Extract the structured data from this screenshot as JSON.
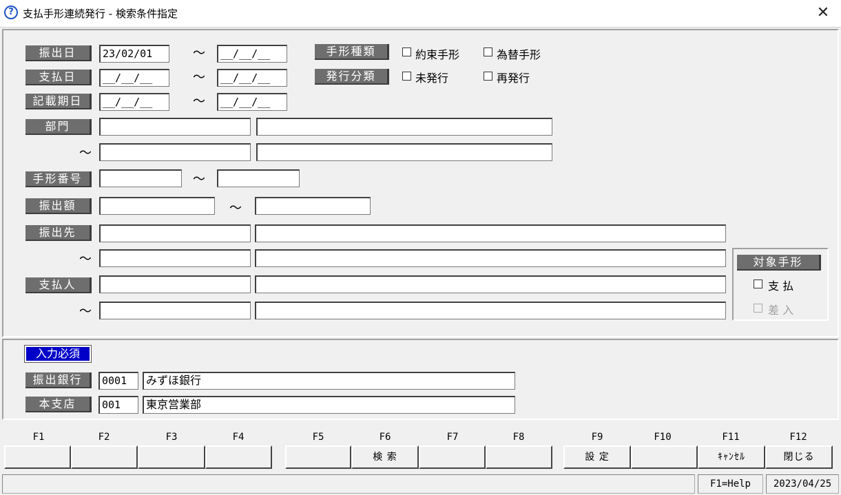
{
  "window": {
    "title": "支払手形連続発行 - 検索条件指定",
    "close": "✕"
  },
  "form": {
    "furidashi_date": {
      "label": "振出日",
      "from": "23/02/01",
      "to": "__/__/__"
    },
    "shiharai_date": {
      "label": "支払日",
      "from": "__/__/__",
      "to": "__/__/__"
    },
    "kisai_date": {
      "label": "記載期日",
      "from": "__/__/__",
      "to": "__/__/__"
    },
    "tilde": "～",
    "tegata_kind": {
      "label": "手形種類",
      "opt1": "約束手形",
      "opt2": "為替手形"
    },
    "hakko_kind": {
      "label": "発行分類",
      "opt1": "未発行",
      "opt2": "再発行"
    },
    "bumon": {
      "label": "部門"
    },
    "tegata_no": {
      "label": "手形番号"
    },
    "amount": {
      "label": "振出額"
    },
    "furidashi_saki": {
      "label": "振出先"
    },
    "shiharai_nin": {
      "label": "支払人"
    },
    "target": {
      "label": "対象手形",
      "opt1": "支 払",
      "opt2": "差 入"
    }
  },
  "required": {
    "label": "入力必須",
    "bank": {
      "label": "振出銀行",
      "code": "0001",
      "name": "みずほ銀行"
    },
    "branch": {
      "label": "本支店",
      "code": "001",
      "name": "東京営業部"
    }
  },
  "fkeys": {
    "labels": [
      "F1",
      "F2",
      "F3",
      "F4",
      "F5",
      "F6",
      "F7",
      "F8",
      "F9",
      "F10",
      "F11",
      "F12"
    ],
    "buttons": [
      "",
      "",
      "",
      "",
      "",
      "検 索",
      "",
      "",
      "設 定",
      "",
      "ｷｬﾝｾﾙ",
      "閉じる"
    ]
  },
  "status": {
    "help": "F1=Help",
    "date": "2023/04/25"
  }
}
